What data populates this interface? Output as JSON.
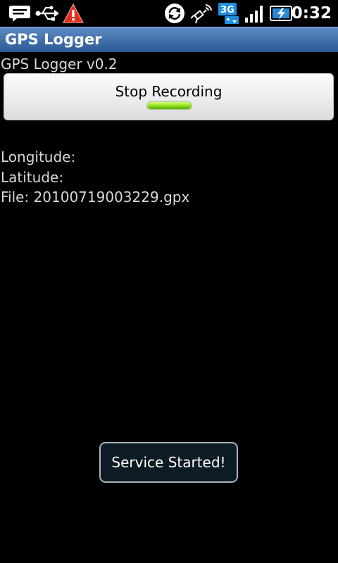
{
  "status_bar": {
    "time": "0:32",
    "icons": [
      "message-icon",
      "usb-icon",
      "warning-icon",
      "sync-icon",
      "gps-icon",
      "3g-icon",
      "signal-icon",
      "battery-icon"
    ],
    "network_badge": "3G"
  },
  "title_bar": {
    "title": "GPS Logger"
  },
  "main": {
    "version": "GPS Logger v0.2",
    "record_button_label": "Stop Recording",
    "longitude_label": "Longitude:",
    "latitude_label": "Latitude:",
    "file_label": "File: 20100719003229.gpx"
  },
  "toast": {
    "message": "Service Started!"
  },
  "colors": {
    "title_bar": "#3f6ea8",
    "indicator_on": "#8bdc1a",
    "warning": "#e03020",
    "network_badge": "#1f8fe0"
  }
}
